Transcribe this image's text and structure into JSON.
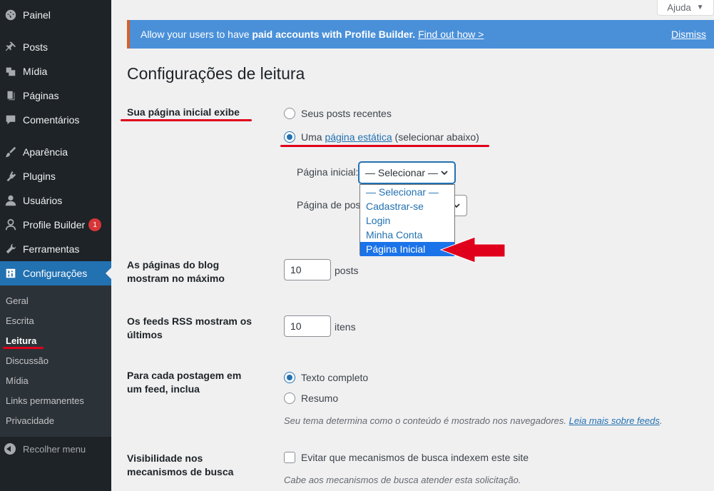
{
  "sidebar": {
    "items": [
      {
        "label": "Painel",
        "icon": "dashboard-icon"
      },
      {
        "label": "Posts",
        "icon": "pin-icon"
      },
      {
        "label": "Mídia",
        "icon": "media-icon"
      },
      {
        "label": "Páginas",
        "icon": "pages-icon"
      },
      {
        "label": "Comentários",
        "icon": "comments-icon"
      },
      {
        "label": "Aparência",
        "icon": "paintbrush-icon"
      },
      {
        "label": "Plugins",
        "icon": "plugin-icon"
      },
      {
        "label": "Usuários",
        "icon": "users-icon"
      },
      {
        "label": "Profile Builder",
        "icon": "user-icon",
        "badge": "1"
      },
      {
        "label": "Ferramentas",
        "icon": "wrench-icon"
      },
      {
        "label": "Configurações",
        "icon": "settings-icon"
      }
    ],
    "submenu": [
      "Geral",
      "Escrita",
      "Leitura",
      "Discussão",
      "Mídia",
      "Links permanentes",
      "Privacidade"
    ],
    "collapse_label": "Recolher menu"
  },
  "help_tab": {
    "label": "Ajuda",
    "arrow": "▼"
  },
  "notice": {
    "text_prefix": "Allow your users to have ",
    "text_bold": "paid accounts with Profile Builder.",
    "link": "Find out how >",
    "dismiss": "Dismiss"
  },
  "page_title": "Configurações de leitura",
  "homepage": {
    "label": "Sua página inicial exibe",
    "option_recent": "Seus posts recentes",
    "option_static_prefix": "Uma",
    "option_static_link": "página estática",
    "option_static_suffix": "(selecionar abaixo)",
    "homepage_label": "Página inicial:",
    "homepage_selected": "— Selecionar —",
    "posts_page_label": "Página de posts:",
    "dropdown_options": [
      "— Selecionar —",
      "Cadastrar-se",
      "Login",
      "Minha Conta",
      "Página Inicial"
    ]
  },
  "blog_pages": {
    "label": "As páginas do blog mostram no máximo",
    "value": "10",
    "suffix": "posts"
  },
  "feeds": {
    "label": "Os feeds RSS mostram os últimos",
    "value": "10",
    "suffix": "itens"
  },
  "feed_content": {
    "label": "Para cada postagem em um feed, inclua",
    "option_full": "Texto completo",
    "option_summary": "Resumo",
    "desc_prefix": "Seu tema determina como o conteúdo é mostrado nos navegadores.",
    "desc_link": "Leia mais sobre feeds",
    "desc_suffix": "."
  },
  "search": {
    "label": "Visibilidade nos mecanismos de busca",
    "checkbox_label": "Evitar que mecanismos de busca indexem este site",
    "desc": "Cabe aos mecanismos de busca atender esta solicitação."
  },
  "colors": {
    "accent": "#2271b1",
    "sidebar": "#1d2327",
    "annotation": "#e0001b",
    "notice": "#4a90d9"
  }
}
